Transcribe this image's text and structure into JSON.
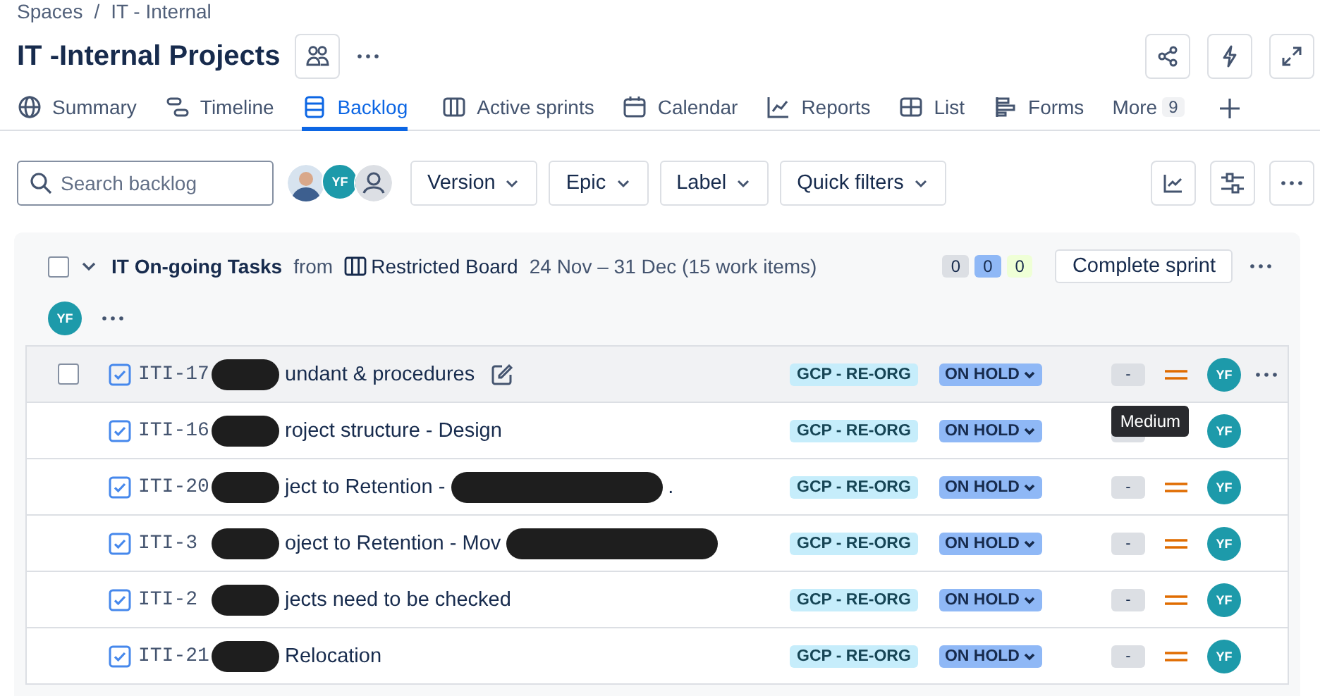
{
  "breadcrumb": {
    "items": [
      "Spaces",
      "IT - Internal"
    ],
    "separator": "/"
  },
  "title": "IT -Internal Projects",
  "tabs": [
    {
      "label": "Summary",
      "selected": false
    },
    {
      "label": "Timeline",
      "selected": false
    },
    {
      "label": "Backlog",
      "selected": true
    },
    {
      "label": "Active sprints",
      "selected": false
    },
    {
      "label": "Calendar",
      "selected": false
    },
    {
      "label": "Reports",
      "selected": false
    },
    {
      "label": "List",
      "selected": false
    },
    {
      "label": "Forms",
      "selected": false
    }
  ],
  "more": {
    "label": "More",
    "count": "9"
  },
  "search": {
    "placeholder": "Search backlog"
  },
  "avatars": [
    {
      "kind": "photo"
    },
    {
      "kind": "initials",
      "text": "YF"
    },
    {
      "kind": "generic"
    }
  ],
  "filters": [
    "Version",
    "Epic",
    "Label",
    "Quick filters"
  ],
  "sprint": {
    "checked": false,
    "name": "IT On-going Tasks",
    "from": "from",
    "board": "Restricted Board",
    "dates": "24 Nov – 31 Dec (15 work items)",
    "counts": [
      {
        "text": "0",
        "color": "#dcdfe4"
      },
      {
        "text": "0",
        "color": "#8fb8f6"
      },
      {
        "text": "0",
        "color": "#efffd6"
      }
    ],
    "complete": "Complete sprint",
    "assignee": "YF"
  },
  "rows": [
    {
      "key": "ITI-17",
      "hovered": true,
      "checked": false,
      "parts": [
        {
          "kind": "redaction"
        },
        {
          "kind": "text",
          "text": "undant & procedures"
        }
      ],
      "epic": "GCP - RE-ORG",
      "status": "ON HOLD",
      "estimate": "-",
      "priority": true,
      "assignee": "YF"
    },
    {
      "key": "ITI-16",
      "hovered": false,
      "parts": [
        {
          "kind": "redaction"
        },
        {
          "kind": "text",
          "text": "roject structure - Design"
        }
      ],
      "epic": "GCP - RE-ORG",
      "status": "ON HOLD",
      "priority": false,
      "assignee": "YF"
    },
    {
      "key": "ITI-20",
      "hovered": false,
      "parts": [
        {
          "kind": "redaction"
        },
        {
          "kind": "text",
          "text": "ject to Retention -"
        },
        {
          "kind": "redaction"
        },
        {
          "kind": "text",
          "text": "."
        }
      ],
      "epic": "GCP - RE-ORG",
      "status": "ON HOLD",
      "estimate": "-",
      "priority": true,
      "assignee": "YF"
    },
    {
      "key": "ITI-3",
      "hovered": false,
      "parts": [
        {
          "kind": "redaction"
        },
        {
          "kind": "text",
          "text": "oject to Retention - Mov"
        },
        {
          "kind": "redaction"
        }
      ],
      "epic": "GCP - RE-ORG",
      "status": "ON HOLD",
      "estimate": "-",
      "priority": true,
      "assignee": "YF"
    },
    {
      "key": "ITI-2",
      "hovered": false,
      "parts": [
        {
          "kind": "redaction"
        },
        {
          "kind": "text",
          "text": "jects need to be checked"
        }
      ],
      "epic": "GCP - RE-ORG",
      "status": "ON HOLD",
      "estimate": "-",
      "priority": true,
      "assignee": "YF"
    },
    {
      "key": "ITI-21",
      "hovered": false,
      "parts": [
        {
          "kind": "redaction"
        },
        {
          "kind": "text",
          "text": "Relocation"
        }
      ],
      "epic": "GCP - RE-ORG",
      "status": "ON HOLD",
      "estimate": "-",
      "priority": true,
      "assignee": "YF"
    }
  ],
  "tooltip": "Medium"
}
